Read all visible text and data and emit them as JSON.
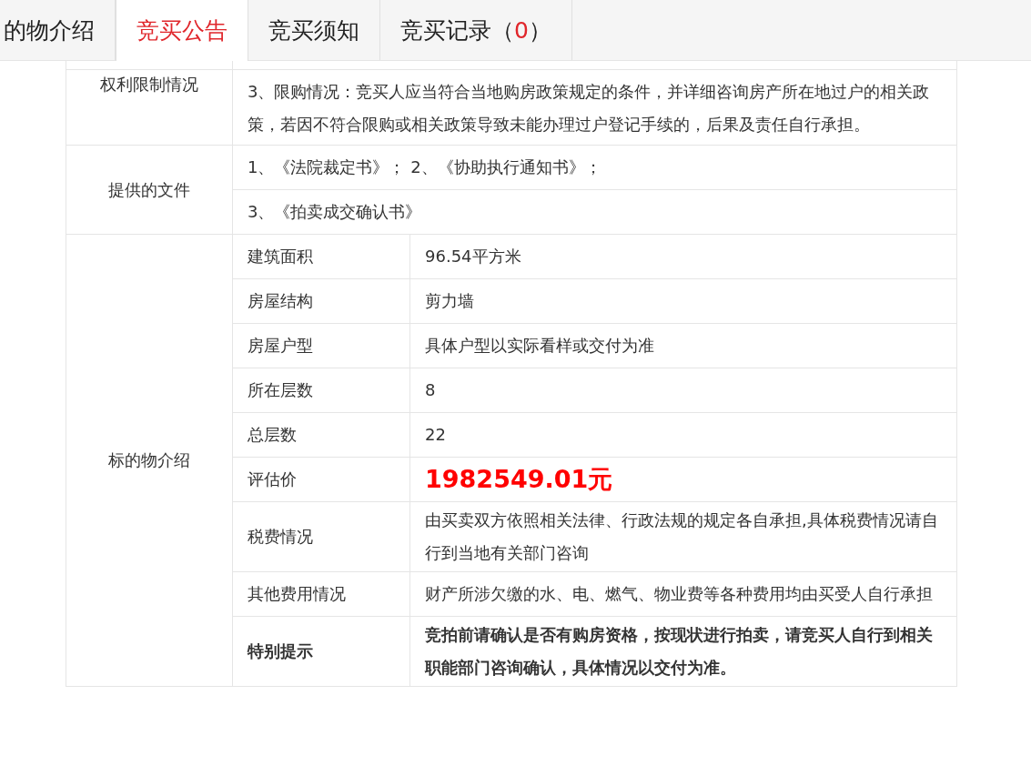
{
  "tabs": [
    {
      "label": "的物介绍",
      "selected": false
    },
    {
      "label": "竞买公告",
      "selected": true
    },
    {
      "label": "竞买须知",
      "selected": false
    },
    {
      "label": "竞买记录（",
      "count": "0",
      "suffix": "）",
      "selected": false
    }
  ],
  "sections": [
    {
      "label": "权利限制情况",
      "kind": "text",
      "rows": [
        "3、限购情况：竞买人应当符合当地购房政策规定的条件，并详细咨询房产所在地过户的相关政策，若因不符合限购或相关政策导致未能办理过户登记手续的，后果及责任自行承担。"
      ]
    },
    {
      "label": "提供的文件",
      "kind": "text",
      "rows": [
        "1、《法院裁定书》； 2、《协助执行通知书》；",
        "3、《拍卖成交确认书》"
      ]
    },
    {
      "label": "标的物介绍",
      "kind": "kv",
      "rows": [
        {
          "key": "建筑面积",
          "value": "96.54平方米",
          "kind": "plain"
        },
        {
          "key": "房屋结构",
          "value": "剪力墙",
          "kind": "plain"
        },
        {
          "key": "房屋户型",
          "value": "具体户型以实际看样或交付为准",
          "kind": "plain"
        },
        {
          "key": "所在层数",
          "value": "8",
          "kind": "plain"
        },
        {
          "key": "总层数",
          "value": "22",
          "kind": "plain"
        },
        {
          "key": "评估价",
          "value": "1982549.01元",
          "kind": "price"
        },
        {
          "key": "税费情况",
          "value": "由买卖双方依照相关法律、行政法规的规定各自承担,具体税费情况请自行到当地有关部门咨询",
          "kind": "plain"
        },
        {
          "key": "其他费用情况",
          "value": "财产所涉欠缴的水、电、燃气、物业费等各种费用均由买受人自行承担",
          "kind": "plain"
        },
        {
          "key": "特别提示",
          "value": "竞拍前请确认是否有购房资格，按现状进行拍卖，请竞买人自行到相关职能部门咨询确认，具体情况以交付为准。",
          "kind": "bold"
        }
      ]
    }
  ]
}
